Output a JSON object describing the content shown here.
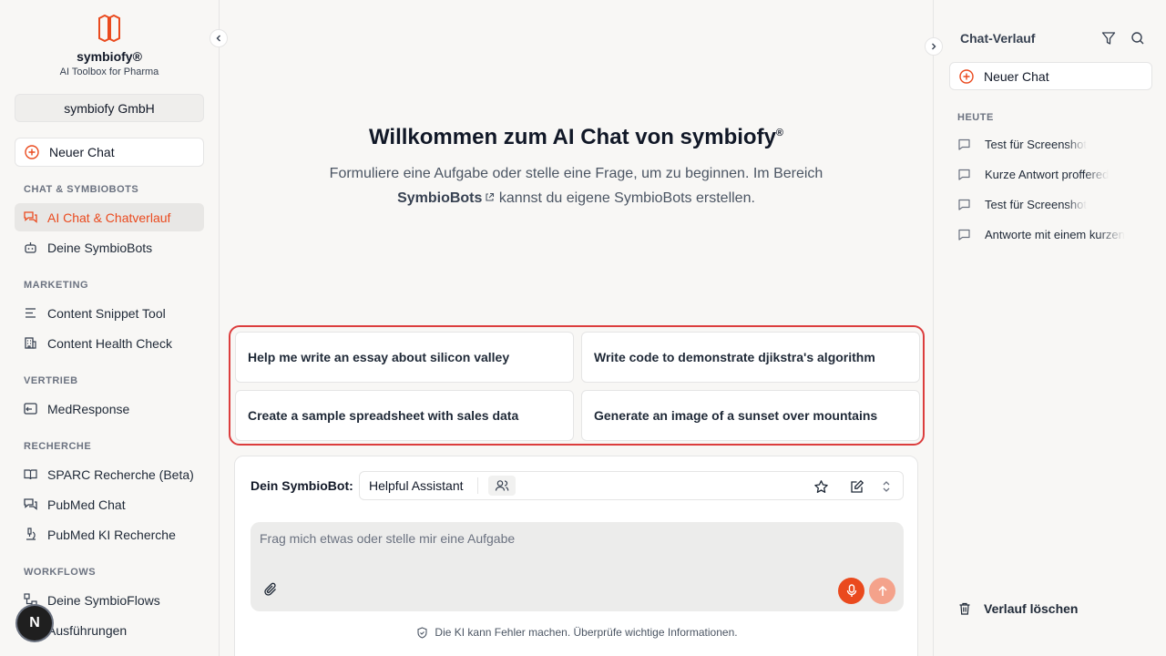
{
  "brand": {
    "name": "symbiofy®",
    "tagline": "AI Toolbox for Pharma",
    "accent": "#ea4a1e"
  },
  "org": {
    "name": "symbiofy GmbH"
  },
  "sidebar": {
    "new_chat": "Neuer Chat",
    "sections": [
      {
        "title": "CHAT & SYMBIOBOTS",
        "items": [
          {
            "label": "AI Chat & Chatverlauf",
            "icon": "chat-icon",
            "active": true
          },
          {
            "label": "Deine SymbioBots",
            "icon": "bot-icon"
          }
        ]
      },
      {
        "title": "MARKETING",
        "items": [
          {
            "label": "Content Snippet Tool",
            "icon": "text-lines-icon"
          },
          {
            "label": "Content Health Check",
            "icon": "building-icon"
          }
        ]
      },
      {
        "title": "VERTRIEB",
        "items": [
          {
            "label": "MedResponse",
            "icon": "reply-icon"
          }
        ]
      },
      {
        "title": "RECHERCHE",
        "items": [
          {
            "label": "SPARC Recherche (Beta)",
            "icon": "book-icon"
          },
          {
            "label": "PubMed Chat",
            "icon": "chat-icon"
          },
          {
            "label": "PubMed KI Recherche",
            "icon": "microscope-icon"
          }
        ]
      },
      {
        "title": "WORKFLOWS",
        "items": [
          {
            "label": "Deine SymbioFlows",
            "icon": "flow-icon"
          },
          {
            "label": "Ausführungen",
            "icon": "list-icon"
          }
        ]
      }
    ]
  },
  "user": {
    "initial": "N"
  },
  "main": {
    "welcome_title": "Willkommen zum AI Chat von symbiofy",
    "welcome_sup": "®",
    "intro_part1": "Formuliere eine Aufgabe oder stelle eine Frage, um zu beginnen. Im Bereich",
    "intro_link": "SymbioBots",
    "intro_part2": "kannst du eigene SymbioBots erstellen.",
    "suggestions": [
      "Help me write an essay about silicon valley",
      "Write code to demonstrate djikstra's algorithm",
      "Create a sample spreadsheet with sales data",
      "Generate an image of a sunset over mountains"
    ],
    "composer": {
      "bot_label": "Dein SymbioBot:",
      "bot_name": "Helpful Assistant",
      "placeholder": "Frag mich etwas oder stelle mir eine Aufgabe",
      "disclaimer": "Die KI kann Fehler machen. Überprüfe wichtige Informationen."
    }
  },
  "history": {
    "title": "Chat-Verlauf",
    "new_chat": "Neuer Chat",
    "today_label": "HEUTE",
    "items": [
      "Test für Screenshot",
      "Kurze Antwort proffered",
      "Test für Screenshot",
      "Antworte mit einem kurzen"
    ],
    "clear_label": "Verlauf löschen"
  }
}
